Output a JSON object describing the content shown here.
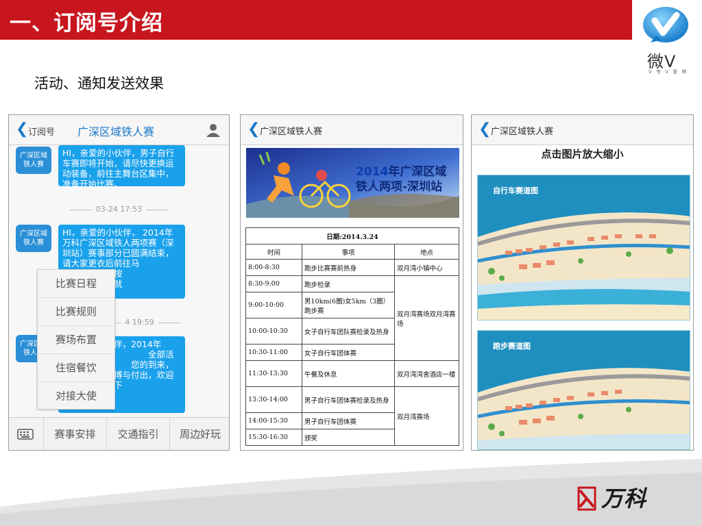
{
  "slide": {
    "title": "一、订阅号介绍",
    "subtitle": "活动、通知发送效果",
    "brand": {
      "weiv_text": "微V",
      "weiv_sub": "V 专 V 管 林",
      "vanke": "万科"
    },
    "colors": {
      "red": "#c8161e",
      "blue": "#1aa1ec"
    }
  },
  "panel1": {
    "nav": {
      "back_label": "订阅号",
      "title": "广深区域铁人赛"
    },
    "messages": [
      {
        "avatar": "广深区域铁人赛",
        "text": "HI，亲爱的小伙伴，男子自行车赛即将开始，请尽快更换运动装备，前往主舞台区集中，准备开始比赛。"
      },
      {
        "avatar": "广深区域铁人赛",
        "text": "HI，亲爱的小伙伴， 2014年万科广深区域铁人两项赛（深圳站）赛事部分已圆满结束，请大家更衣后前往马　　　　　用餐，围桌未按　　　　　分，您可随意就"
      },
      {
        "avatar": "广深区域铁人赛",
        "text": "　　　　小伙伴，2014年　　　　域铁人两项赛　　　　全部活动已圆满　　　　您的到来，感谢　　　　博与付出，欢迎　　　　双月湾，期待下"
      }
    ],
    "timestamps": [
      "03-24 17:53",
      "4 19:59"
    ],
    "menu": [
      "比赛日程",
      "比赛规则",
      "赛场布置",
      "住宿餐饮",
      "对接大使"
    ],
    "tabs": [
      "赛事安排",
      "交通指引",
      "周边好玩"
    ]
  },
  "panel2": {
    "nav": {
      "title": "广深区域铁人赛"
    },
    "banner": {
      "year": "2014",
      "line1": "年广深区域",
      "line2": "铁人两项-深圳站"
    },
    "table": {
      "date": "日期:2014.3.24",
      "headers": [
        "时间",
        "事项",
        "地点"
      ],
      "rows": [
        {
          "time": "8:00-8:30",
          "item": "跑步比赛赛前热身",
          "place": "双月湾小镇中心"
        },
        {
          "time": "8:30-9:00",
          "item": "跑步检录"
        },
        {
          "time": "9:00-10:00",
          "item": "男10km(6圈)女5km（3圈）跑步赛"
        },
        {
          "time": "10:00-10:30",
          "item": "女子自行车团队赛检录及热身"
        },
        {
          "time": "10:30-11:00",
          "item": "女子自行车团体赛"
        },
        {
          "time": "11:30-13:30",
          "item": "午餐及休息",
          "place": "双月湾湾舍酒店一楼"
        },
        {
          "time": "13:30-14:00",
          "item": "男子自行车团体赛检录及热身"
        },
        {
          "time": "14:00-15:30",
          "item": "男子自行车团体赛"
        },
        {
          "time": "15:30-16:30",
          "item": "颁奖"
        }
      ],
      "merged_place_a": "双月湾赛场双月湾赛场",
      "merged_place_b": "双月湾赛场"
    }
  },
  "panel3": {
    "nav": {
      "title": "广深区域铁人赛"
    },
    "tip": "点击图片放大缩小",
    "maps": [
      "自行车赛道图",
      "跑步赛道图"
    ]
  }
}
